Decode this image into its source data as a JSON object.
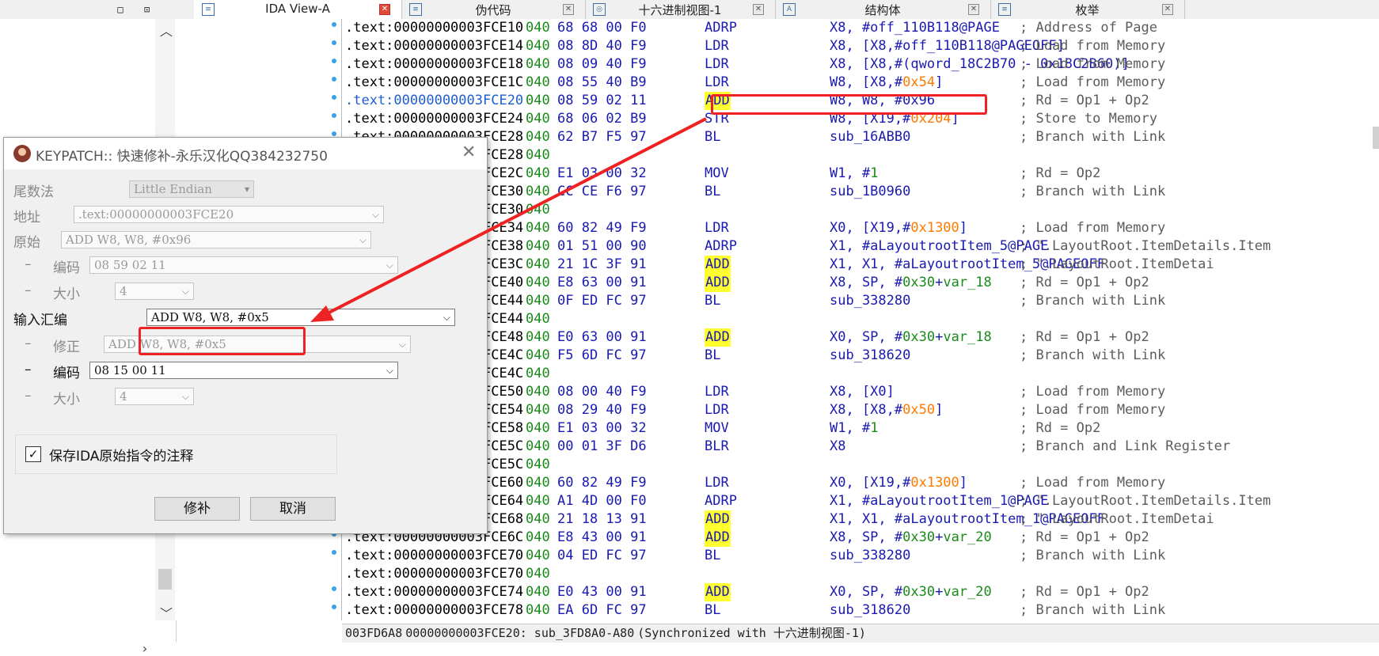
{
  "left_panel": {
    "window_buttons": [
      "□",
      "⊡",
      "✕"
    ],
    "scroll_up": "︿",
    "scroll_down": "﹀",
    "scroll_right": "›"
  },
  "tabs": [
    {
      "label": "IDA View-A",
      "icon": "ida-view-icon",
      "active": true
    },
    {
      "label": "伪代码",
      "icon": "pseudocode-icon",
      "active": false
    },
    {
      "label": "十六进制视图-1",
      "icon": "hex-view-icon",
      "active": false
    },
    {
      "label": "结构体",
      "icon": "structures-icon",
      "active": false
    },
    {
      "label": "枚举",
      "icon": "enums-icon",
      "active": false
    }
  ],
  "code_lines": [
    {
      "seg": ".text:00000000003FCE10",
      "cnt": "040",
      "bytes": "68 68 00 F0",
      "mnem": "ADRP",
      "ops": [
        [
          "X8, #off_110B118@PAGE",
          "t"
        ]
      ],
      "comment": "; Address of Page"
    },
    {
      "seg": ".text:00000000003FCE14",
      "cnt": "040",
      "bytes": "08 8D 40 F9",
      "mnem": "LDR",
      "ops": [
        [
          "X8, [X8,#off_110B118@PAGEOFF]",
          "t"
        ]
      ],
      "comment": "; Load from Memory"
    },
    {
      "seg": ".text:00000000003FCE18",
      "cnt": "040",
      "bytes": "08 09 40 F9",
      "mnem": "LDR",
      "ops": [
        [
          "X8, [X8,#(qword_18C2B70 - 0x18C2B60)]",
          "t"
        ]
      ],
      "comment": "; Load from Memory"
    },
    {
      "seg": ".text:00000000003FCE1C",
      "cnt": "040",
      "bytes": "08 55 40 B9",
      "mnem": "LDR",
      "ops": [
        [
          "W8, [X8,#",
          "t"
        ],
        [
          "0x54",
          "h"
        ],
        [
          "]",
          "t"
        ]
      ],
      "comment": "; Load from Memory"
    },
    {
      "seg": ".text:00000000003FCE20",
      "cnt": "040",
      "bytes": "08 59 02 11",
      "mnem": "ADD",
      "ops": [
        [
          "W8, W8, #0x96",
          "t"
        ]
      ],
      "comment": "; Rd = Op1 + Op2",
      "current": true,
      "yellow": true
    },
    {
      "seg": ".text:00000000003FCE24",
      "cnt": "040",
      "bytes": "68 06 02 B9",
      "mnem": "STR",
      "ops": [
        [
          "W8, [X19,#",
          "t"
        ],
        [
          "0x204",
          "h"
        ],
        [
          "]",
          "t"
        ]
      ],
      "comment": "; Store to Memory"
    },
    {
      "seg": ".text:00000000003FCE28",
      "cnt": "040",
      "bytes": "62 B7 F5 97",
      "mnem": "BL",
      "ops": [
        [
          "sub_16ABB0",
          "t"
        ]
      ],
      "comment": "; Branch with Link"
    },
    {
      "seg": ".text:00000000003FCE28",
      "cnt": "040",
      "bytes": "",
      "mnem": "",
      "ops": [],
      "comment": ""
    },
    {
      "seg": ".text:00000000003FCE2C",
      "cnt": "040",
      "bytes": "E1 03 00 32",
      "mnem": "MOV",
      "ops": [
        [
          "W1, #",
          "t"
        ],
        [
          "1",
          "n"
        ]
      ],
      "comment": "; Rd = Op2"
    },
    {
      "seg": ".text:00000000003FCE30",
      "cnt": "040",
      "bytes": "CC CE F6 97",
      "mnem": "BL",
      "ops": [
        [
          "sub_1B0960",
          "t"
        ]
      ],
      "comment": "; Branch with Link"
    },
    {
      "seg": ".text:00000000003FCE30",
      "cnt": "040",
      "bytes": "",
      "mnem": "",
      "ops": [],
      "comment": ""
    },
    {
      "seg": ".text:00000000003FCE34",
      "cnt": "040",
      "bytes": "60 82 49 F9",
      "mnem": "LDR",
      "ops": [
        [
          "X0, [X19,#",
          "t"
        ],
        [
          "0x1300",
          "h"
        ],
        [
          "]",
          "t"
        ]
      ],
      "comment": "; Load from Memory"
    },
    {
      "seg": ".text:00000000003FCE38",
      "cnt": "040",
      "bytes": "01 51 00 90",
      "mnem": "ADRP",
      "ops": [
        [
          "X1, #aLayoutrootItem_5@PAGE",
          "t"
        ]
      ],
      "comment": "; \".LayoutRoot.ItemDetails.Item"
    },
    {
      "seg": ".text:00000000003FCE3C",
      "cnt": "040",
      "bytes": "21 1C 3F 91",
      "mnem": "ADD",
      "ops": [
        [
          "X1, X1, #aLayoutrootItem_5@PAGEOFF",
          "t"
        ]
      ],
      "comment": "; \".LayoutRoot.ItemDetai",
      "yellow": true
    },
    {
      "seg": ".text:00000000003FCE40",
      "cnt": "040",
      "bytes": "E8 63 00 91",
      "mnem": "ADD",
      "ops": [
        [
          "X8, SP, #",
          "t"
        ],
        [
          "0x30",
          "n"
        ],
        [
          "+",
          "t"
        ],
        [
          "var_18",
          "n"
        ]
      ],
      "comment": "; Rd = Op1 + Op2",
      "yellow": true
    },
    {
      "seg": ".text:00000000003FCE44",
      "cnt": "040",
      "bytes": "0F ED FC 97",
      "mnem": "BL",
      "ops": [
        [
          "sub_338280",
          "t"
        ]
      ],
      "comment": "; Branch with Link"
    },
    {
      "seg": ".text:00000000003FCE44",
      "cnt": "040",
      "bytes": "",
      "mnem": "",
      "ops": [],
      "comment": ""
    },
    {
      "seg": ".text:00000000003FCE48",
      "cnt": "040",
      "bytes": "E0 63 00 91",
      "mnem": "ADD",
      "ops": [
        [
          "X0, SP, #",
          "t"
        ],
        [
          "0x30",
          "n"
        ],
        [
          "+",
          "t"
        ],
        [
          "var_18",
          "n"
        ]
      ],
      "comment": "; Rd = Op1 + Op2",
      "yellow": true
    },
    {
      "seg": ".text:00000000003FCE4C",
      "cnt": "040",
      "bytes": "F5 6D FC 97",
      "mnem": "BL",
      "ops": [
        [
          "sub_318620",
          "t"
        ]
      ],
      "comment": "; Branch with Link"
    },
    {
      "seg": ".text:00000000003FCE4C",
      "cnt": "040",
      "bytes": "",
      "mnem": "",
      "ops": [],
      "comment": ""
    },
    {
      "seg": ".text:00000000003FCE50",
      "cnt": "040",
      "bytes": "08 00 40 F9",
      "mnem": "LDR",
      "ops": [
        [
          "X8, [X0]",
          "t"
        ]
      ],
      "comment": "; Load from Memory"
    },
    {
      "seg": ".text:00000000003FCE54",
      "cnt": "040",
      "bytes": "08 29 40 F9",
      "mnem": "LDR",
      "ops": [
        [
          "X8, [X8,#",
          "t"
        ],
        [
          "0x50",
          "h"
        ],
        [
          "]",
          "t"
        ]
      ],
      "comment": "; Load from Memory"
    },
    {
      "seg": ".text:00000000003FCE58",
      "cnt": "040",
      "bytes": "E1 03 00 32",
      "mnem": "MOV",
      "ops": [
        [
          "W1, #",
          "t"
        ],
        [
          "1",
          "n"
        ]
      ],
      "comment": "; Rd = Op2"
    },
    {
      "seg": ".text:00000000003FCE5C",
      "cnt": "040",
      "bytes": "00 01 3F D6",
      "mnem": "BLR",
      "ops": [
        [
          "X8",
          "t"
        ]
      ],
      "comment": "; Branch and Link Register"
    },
    {
      "seg": ".text:00000000003FCE5C",
      "cnt": "040",
      "bytes": "",
      "mnem": "",
      "ops": [],
      "comment": ""
    },
    {
      "seg": ".text:00000000003FCE60",
      "cnt": "040",
      "bytes": "60 82 49 F9",
      "mnem": "LDR",
      "ops": [
        [
          "X0, [X19,#",
          "t"
        ],
        [
          "0x1300",
          "h"
        ],
        [
          "]",
          "t"
        ]
      ],
      "comment": "; Load from Memory"
    },
    {
      "seg": ".text:00000000003FCE64",
      "cnt": "040",
      "bytes": "A1 4D 00 F0",
      "mnem": "ADRP",
      "ops": [
        [
          "X1, #aLayoutrootItem_1@PAGE",
          "t"
        ]
      ],
      "comment": "; \".LayoutRoot.ItemDetails.Item"
    },
    {
      "seg": ".text:00000000003FCE68",
      "cnt": "040",
      "bytes": "21 18 13 91",
      "mnem": "ADD",
      "ops": [
        [
          "X1, X1, #aLayoutrootItem_1@PAGEOFF",
          "t"
        ]
      ],
      "comment": "; \".LayoutRoot.ItemDetai",
      "yellow": true
    },
    {
      "seg": ".text:00000000003FCE6C",
      "cnt": "040",
      "bytes": "E8 43 00 91",
      "mnem": "ADD",
      "ops": [
        [
          "X8, SP, #",
          "t"
        ],
        [
          "0x30",
          "n"
        ],
        [
          "+",
          "t"
        ],
        [
          "var_20",
          "n"
        ]
      ],
      "comment": "; Rd = Op1 + Op2",
      "yellow": true
    },
    {
      "seg": ".text:00000000003FCE70",
      "cnt": "040",
      "bytes": "04 ED FC 97",
      "mnem": "BL",
      "ops": [
        [
          "sub_338280",
          "t"
        ]
      ],
      "comment": "; Branch with Link"
    },
    {
      "seg": ".text:00000000003FCE70",
      "cnt": "040",
      "bytes": "",
      "mnem": "",
      "ops": [],
      "comment": ""
    },
    {
      "seg": ".text:00000000003FCE74",
      "cnt": "040",
      "bytes": "E0 43 00 91",
      "mnem": "ADD",
      "ops": [
        [
          "X0, SP, #",
          "t"
        ],
        [
          "0x30",
          "n"
        ],
        [
          "+",
          "t"
        ],
        [
          "var_20",
          "n"
        ]
      ],
      "comment": "; Rd = Op1 + Op2",
      "yellow": true
    },
    {
      "seg": ".text:00000000003FCE78",
      "cnt": "040",
      "bytes": "EA 6D FC 97",
      "mnem": "BL",
      "ops": [
        [
          "sub_318620",
          "t"
        ]
      ],
      "comment": "; Branch with Link"
    }
  ],
  "status_bar": {
    "offset": "003FD6A8",
    "location": "00000000003FCE20: sub_3FD8A0-A80",
    "sync": "(Synchronized with 十六进制视图-1)"
  },
  "dialog": {
    "title": "KEYPATCH:: 快速修补-永乐汉化QQ384232750",
    "close": "✕",
    "endian_label": "尾数法",
    "endian_value": "Little Endian",
    "address_label": "地址",
    "address_value": ".text:00000000003FCE20",
    "original_label": "原始",
    "original_value": "ADD W8, W8, #0x96",
    "dash": "–",
    "orig_encoding_label": "编码",
    "orig_encoding_value": "08 59 02 11",
    "orig_size_label": "大小",
    "orig_size_value": "4",
    "input_label": "输入汇编",
    "input_value": "ADD W8, W8, #0x5",
    "fixup_label": "修正",
    "fixup_value": "ADD W8, W8, #0x5",
    "new_encoding_label": "编码",
    "new_encoding_value": "08 15 00 11",
    "new_size_label": "大小",
    "new_size_value": "4",
    "keep_comment_label": "保存IDA原始指令的注释",
    "keep_comment_checked": true,
    "patch_button": "修补",
    "cancel_button": "取消"
  },
  "annotation_color": "#ee2222"
}
